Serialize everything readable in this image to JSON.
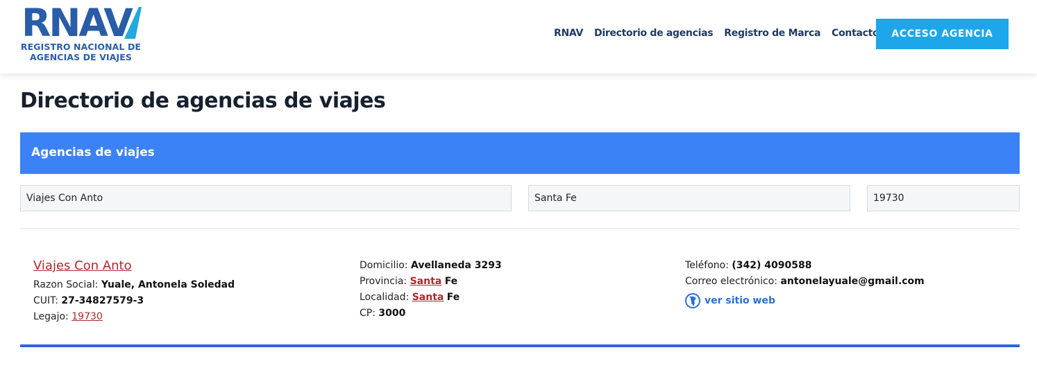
{
  "logo": {
    "word": "RNAV",
    "line1": "REGISTRO NACIONAL DE",
    "line2": "AGENCIAS DE VIAJES"
  },
  "nav": {
    "items": [
      "RNAV",
      "Directorio de agencias",
      "Registro de Marca",
      "Contacto"
    ],
    "cta": "ACCESO AGENCIA"
  },
  "page": {
    "title": "Directorio de agencias de viajes"
  },
  "banner": {
    "title": "Agencias de viajes"
  },
  "filters": {
    "name": "Viajes Con Anto",
    "province": "Santa Fe",
    "legajo": "19730"
  },
  "agency": {
    "name": "Viajes Con Anto",
    "razon_label": "Razon Social:",
    "razon": "Yuale, Antonela Soledad",
    "cuit_label": "CUIT:",
    "cuit": "27-34827579-3",
    "legajo_label": "Legajo:",
    "legajo": "19730",
    "domicilio_label": "Domicilio:",
    "domicilio": "Avellaneda 3293",
    "provincia_label": "Provincia:",
    "provincia_link": "Santa",
    "provincia_rest": "Fe",
    "localidad_label": "Localidad:",
    "localidad_link": "Santa",
    "localidad_rest": "Fe",
    "cp_label": "CP:",
    "cp": "3000",
    "telefono_label": "Teléfono:",
    "telefono": "(342) 4090588",
    "correo_label": "Correo electrónico:",
    "correo": "antonelayuale@gmail.com",
    "web_label": "ver sitio web"
  },
  "colors": {
    "accent": "#3b82f6",
    "cta": "#1ea6ea",
    "brand": "#2a5da8",
    "link": "#b2262c"
  }
}
